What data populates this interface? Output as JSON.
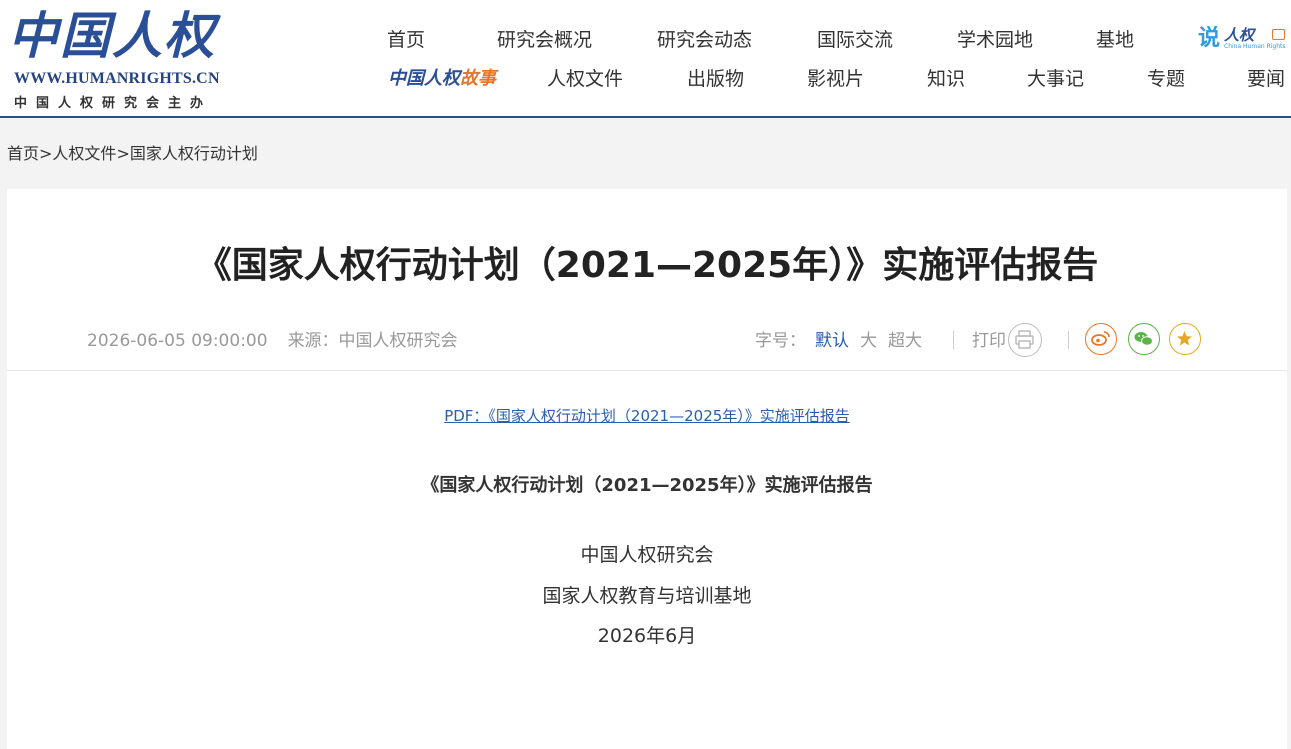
{
  "header": {
    "logo_main": "中国人权",
    "logo_url": "WWW.HUMANRIGHTS.CN",
    "logo_sub": "中国人权研究会主办",
    "nav_row1": [
      "首页",
      "研究会概况",
      "研究会动态",
      "国际交流",
      "学术园地",
      "基地"
    ],
    "nav_row2": [
      "人权文件",
      "出版物",
      "影视片",
      "知识",
      "大事记",
      "专题",
      "要闻"
    ],
    "story_logo": {
      "part1": "中国人权",
      "part2": "故事"
    },
    "shuo_logo": {
      "shuo": "说",
      "text": "人权",
      "en": "China Human Rights"
    }
  },
  "breadcrumb": [
    "首页",
    "人权文件",
    "国家人权行动计划"
  ],
  "breadcrumb_sep": ">",
  "article": {
    "title": "《国家人权行动计划（2021—2025年）》实施评估报告",
    "date": "2026-06-05 09:00:00",
    "source": "来源：中国人权研究会",
    "font_size_label": "字号：",
    "font_sizes": [
      "默认",
      "大",
      "超大"
    ],
    "print_label": "打印",
    "pdf_link": "PDF：《国家人权行动计划（2021—2025年）》实施评估报告",
    "doc_title": "《国家人权行动计划（2021—2025年）》实施评估报告",
    "doc_lines": [
      "中国人权研究会",
      "国家人权教育与培训基地",
      "2026年6月"
    ]
  },
  "share": {
    "icons": [
      "weibo-icon",
      "wechat-icon",
      "favorite-icon"
    ],
    "colors": {
      "weibo": "#e8752a",
      "wechat": "#5bb34a",
      "favorite": "#e6a822"
    }
  },
  "colors": {
    "brand": "#2a4f96",
    "link": "#2a5db0",
    "header_border": "#2b4a8b"
  }
}
